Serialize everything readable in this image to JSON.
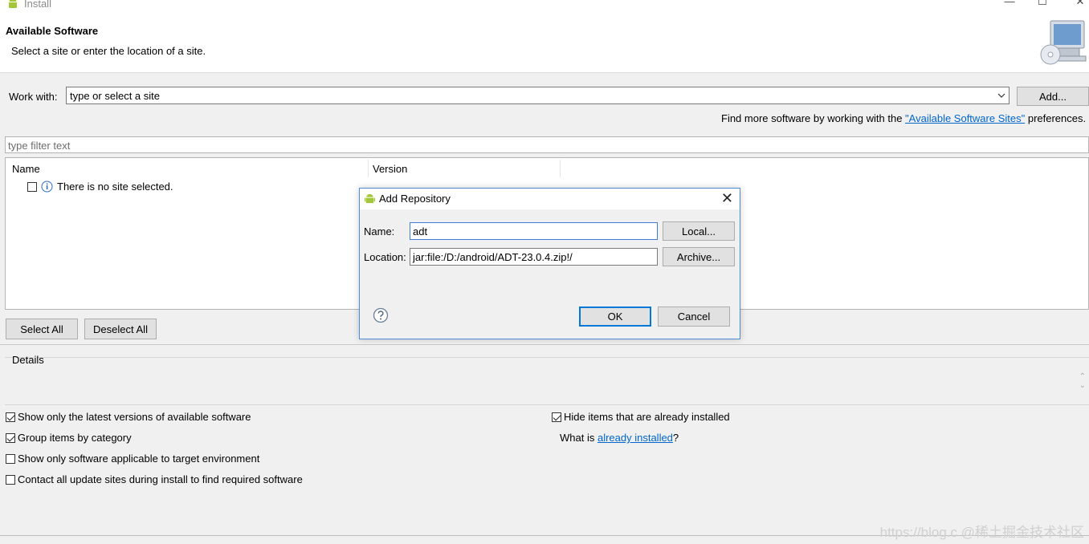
{
  "window": {
    "title": "Install"
  },
  "banner": {
    "title": "Available Software",
    "subtitle": "Select a site or enter the location of a site."
  },
  "work_with": {
    "label": "Work with:",
    "value": "type or select a site",
    "add_label": "Add..."
  },
  "find_more": {
    "prefix": "Find more software by working with the ",
    "link": "\"Available Software Sites\"",
    "suffix": " preferences."
  },
  "filter": {
    "placeholder": "type filter text"
  },
  "tree": {
    "columns": [
      "Name",
      "Version"
    ],
    "message": "There is no site selected."
  },
  "buttons": {
    "select_all": "Select All",
    "deselect_all": "Deselect All"
  },
  "details": {
    "label": "Details"
  },
  "options": {
    "latest_versions": {
      "label": "Show only the latest versions of available software",
      "checked": true
    },
    "group_by_category": {
      "label": "Group items by category",
      "checked": true
    },
    "applicable_only": {
      "label": "Show only software applicable to target environment",
      "checked": false
    },
    "contact_all": {
      "label": "Contact all update sites during install to find required software",
      "checked": false
    },
    "hide_installed": {
      "label": "Hide items that are already installed",
      "checked": true
    }
  },
  "what_is": {
    "prefix": "What is ",
    "link": "already installed",
    "suffix": "?"
  },
  "watermark": "https://blog.c @稀土掘金技术社区",
  "dialog": {
    "title": "Add Repository",
    "name_label": "Name:",
    "name_value": "adt",
    "location_label": "Location:",
    "location_value": "jar:file:/D:/android/ADT-23.0.4.zip!/",
    "local_label": "Local...",
    "archive_label": "Archive...",
    "ok_label": "OK",
    "cancel_label": "Cancel"
  },
  "colors": {
    "android_green": "#a4c639",
    "link": "#0066cc",
    "focus_blue": "#0078d7"
  },
  "icons": [
    "android-icon",
    "minimize-icon",
    "maximize-icon",
    "close-icon",
    "install-cd-icon",
    "dropdown-arrow-icon",
    "info-icon",
    "help-icon"
  ]
}
